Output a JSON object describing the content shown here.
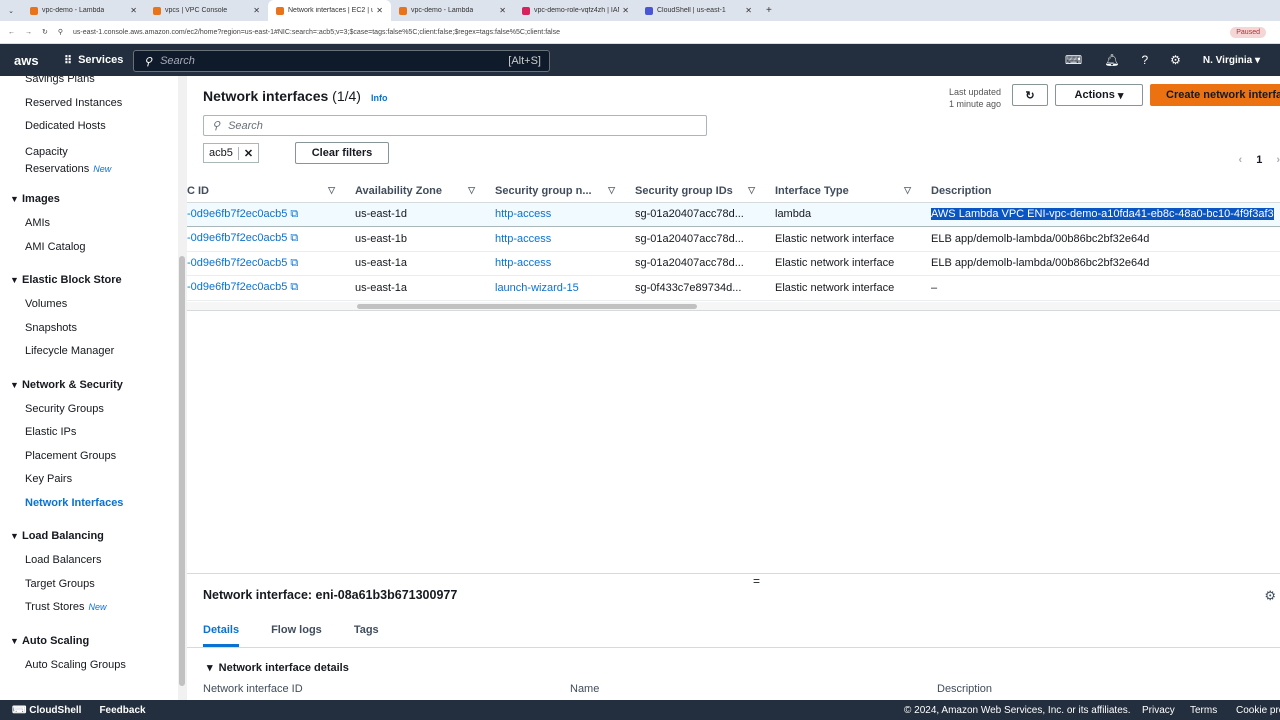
{
  "browser": {
    "tabs": [
      {
        "label": "vpc-demo - Lambda",
        "color": "#e8731b"
      },
      {
        "label": "vpcs | VPC Console",
        "color": "#e8731b"
      },
      {
        "label": "Network interfaces | EC2 | us-e",
        "color": "#e8731b"
      },
      {
        "label": "vpc-demo - Lambda",
        "color": "#e8731b"
      },
      {
        "label": "vpc-demo-role-vqfz4zh | IAM",
        "color": "#d6235c"
      },
      {
        "label": "CloudShell | us-east-1",
        "color": "#4a55d6"
      }
    ],
    "url": "us-east-1.console.aws.amazon.com/ec2/home?region=us-east-1#NIC:search=:acb5;v=3;$case=tags:false%5C;client:false;$regex=tags:false%5C;client:false",
    "profile": "Paused"
  },
  "nav": {
    "logo": "aws",
    "services": "Services",
    "search_placeholder": "Search",
    "search_shortcut": "[Alt+S]",
    "region": "N. Virginia"
  },
  "sidebar": {
    "items": [
      {
        "label": "Savings Plans"
      },
      {
        "label": "Reserved Instances"
      },
      {
        "label": "Dedicated Hosts"
      },
      {
        "label": "Capacity Reservations",
        "badge": "New"
      }
    ],
    "sections": [
      {
        "title": "Images",
        "items": [
          "AMIs",
          "AMI Catalog"
        ]
      },
      {
        "title": "Elastic Block Store",
        "items": [
          "Volumes",
          "Snapshots",
          "Lifecycle Manager"
        ]
      },
      {
        "title": "Network & Security",
        "items": [
          "Security Groups",
          "Elastic IPs",
          "Placement Groups",
          "Key Pairs",
          "Network Interfaces"
        ]
      },
      {
        "title": "Load Balancing",
        "items": [
          "Load Balancers",
          "Target Groups",
          "Trust Stores"
        ]
      },
      {
        "title": "Auto Scaling",
        "items": [
          "Auto Scaling Groups"
        ]
      }
    ],
    "new_badge": "New"
  },
  "main": {
    "title": "Network interfaces",
    "count": "(1/4)",
    "info": "Info",
    "last_updated_label": "Last updated",
    "last_updated": "1 minute ago",
    "actions": "Actions",
    "create": "Create network interface",
    "search_placeholder": "Search",
    "filter_token": "acb5",
    "clear_filters": "Clear filters",
    "page": "1",
    "columns": [
      "C ID",
      "Availability Zone",
      "Security group n...",
      "Security group IDs",
      "Interface Type",
      "Description"
    ],
    "rows": [
      [
        "-0d9e6fb7f2ec0acb5",
        "us-east-1d",
        "http-access",
        "sg-01a20407acc78d...",
        "lambda",
        "AWS Lambda VPC ENI-vpc-demo-a10fda41-eb8c-48a0-bc10-4f9f3af3"
      ],
      [
        "-0d9e6fb7f2ec0acb5",
        "us-east-1b",
        "http-access",
        "sg-01a20407acc78d...",
        "Elastic network interface",
        "ELB app/demolb-lambda/00b86bc2bf32e64d"
      ],
      [
        "-0d9e6fb7f2ec0acb5",
        "us-east-1a",
        "http-access",
        "sg-01a20407acc78d...",
        "Elastic network interface",
        "ELB app/demolb-lambda/00b86bc2bf32e64d"
      ],
      [
        "-0d9e6fb7f2ec0acb5",
        "us-east-1a",
        "launch-wizard-15",
        "sg-0f433c7e89734d...",
        "Elastic network interface",
        "–"
      ]
    ]
  },
  "detail": {
    "title": "Network interface: eni-08a61b3b671300977",
    "tabs": [
      "Details",
      "Flow logs",
      "Tags"
    ],
    "section": "Network interface details",
    "labels": [
      "Network interface ID",
      "Name",
      "Description"
    ]
  },
  "footer": {
    "cloudshell": "CloudShell",
    "feedback": "Feedback",
    "copyright": "© 2024, Amazon Web Services, Inc. or its affiliates.",
    "privacy": "Privacy",
    "terms": "Terms",
    "cookie": "Cookie preferences"
  }
}
